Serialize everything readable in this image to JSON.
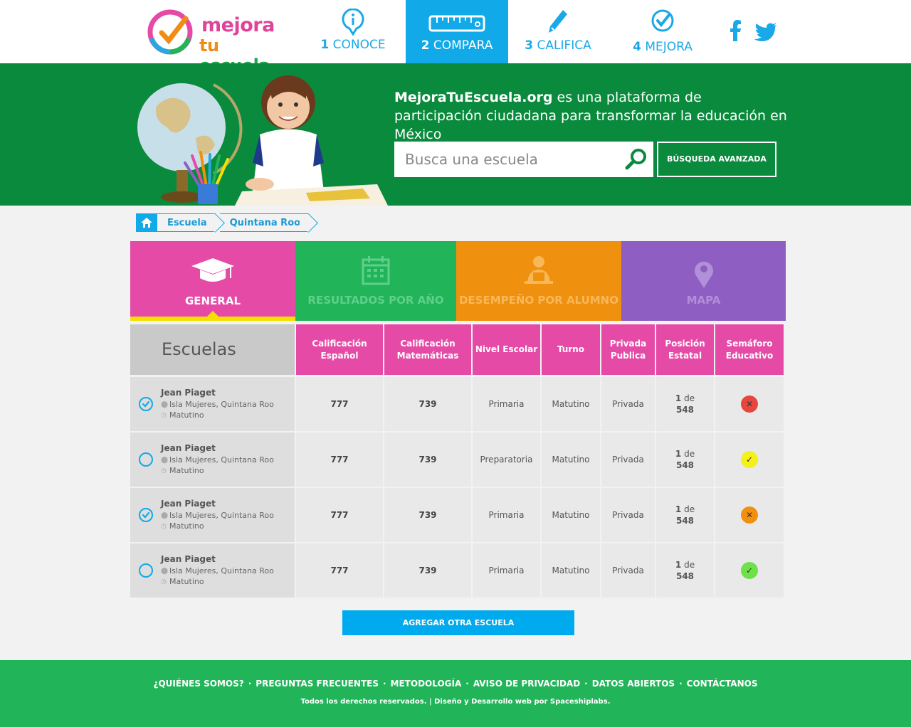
{
  "brand": {
    "line1": "mejora",
    "line2a": "tu",
    "line2b": " escuela"
  },
  "nav": [
    {
      "num": "1",
      "label": "CONOCE"
    },
    {
      "num": "2",
      "label": "COMPARA"
    },
    {
      "num": "3",
      "label": "CALIFICA"
    },
    {
      "num": "4",
      "label": "MEJORA"
    }
  ],
  "hero": {
    "site": "MejoraTuEscuela.org",
    "tagline": " es una plataforma de participación ciudadana para transformar la educación en México",
    "search_placeholder": "Busca una escuela",
    "advanced_label": "BÚSQUEDA AVANZADA"
  },
  "breadcrumb": [
    "Escuela",
    "Quintana Roo"
  ],
  "tabs": [
    "GENERAL",
    "RESULTADOS POR AÑO",
    "DESEMPEÑO POR ALUMNO",
    "MAPA"
  ],
  "table": {
    "first_header": "Escuelas",
    "headers": [
      "Calificación Español",
      "Calificación Matemáticas",
      "Nivel Escolar",
      "Turno",
      "Privada Publica",
      "Posición Estatal",
      "Semáforo Educativo"
    ],
    "rows": [
      {
        "name": "Jean Piaget",
        "location": "Isla Mujeres, Quintana Roo",
        "shift": "Matutino",
        "checked": true,
        "espanol": "777",
        "matematicas": "739",
        "nivel": "Primaria",
        "turno": "Matutino",
        "tipo": "Privada",
        "pos": "1",
        "de": " de",
        "total": "548",
        "sem_color": "#e8453c",
        "sem_glyph": "✕"
      },
      {
        "name": "Jean Piaget",
        "location": "Isla Mujeres, Quintana Roo",
        "shift": "Matutino",
        "checked": false,
        "espanol": "777",
        "matematicas": "739",
        "nivel": "Preparatoria",
        "turno": "Matutino",
        "tipo": "Privada",
        "pos": "1",
        "de": " de",
        "total": "548",
        "sem_color": "#f3f01a",
        "sem_glyph": "✓"
      },
      {
        "name": "Jean Piaget",
        "location": "Isla Mujeres, Quintana Roo",
        "shift": "Matutino",
        "checked": true,
        "espanol": "777",
        "matematicas": "739",
        "nivel": "Primaria",
        "turno": "Matutino",
        "tipo": "Privada",
        "pos": "1",
        "de": " de",
        "total": "548",
        "sem_color": "#f0900f",
        "sem_glyph": "✕"
      },
      {
        "name": "Jean Piaget",
        "location": "Isla Mujeres, Quintana Roo",
        "shift": "Matutino",
        "checked": false,
        "espanol": "777",
        "matematicas": "739",
        "nivel": "Primaria",
        "turno": "Matutino",
        "tipo": "Privada",
        "pos": "1",
        "de": " de",
        "total": "548",
        "sem_color": "#6ee04a",
        "sem_glyph": "✓"
      }
    ]
  },
  "add_button": "AGREGAR OTRA ESCUELA",
  "footer": {
    "links": [
      "¿QUIÉNES SOMOS?",
      "PREGUNTAS FRECUENTES",
      "METODOLOGÍA",
      "AVISO DE PRIVACIDAD",
      "DATOS ABIERTOS",
      "CONTÁCTANOS"
    ],
    "separator": "·",
    "copyright": "Todos los derechos reservados. | Diseño y Desarrollo web por Spaceshiplabs."
  },
  "colors": {
    "accent": "#11a9e7",
    "hero_green": "#0a8a3c",
    "footer_green": "#22b459",
    "pink": "#e64aa7",
    "orange": "#f0900f",
    "purple": "#8e5ec2"
  }
}
